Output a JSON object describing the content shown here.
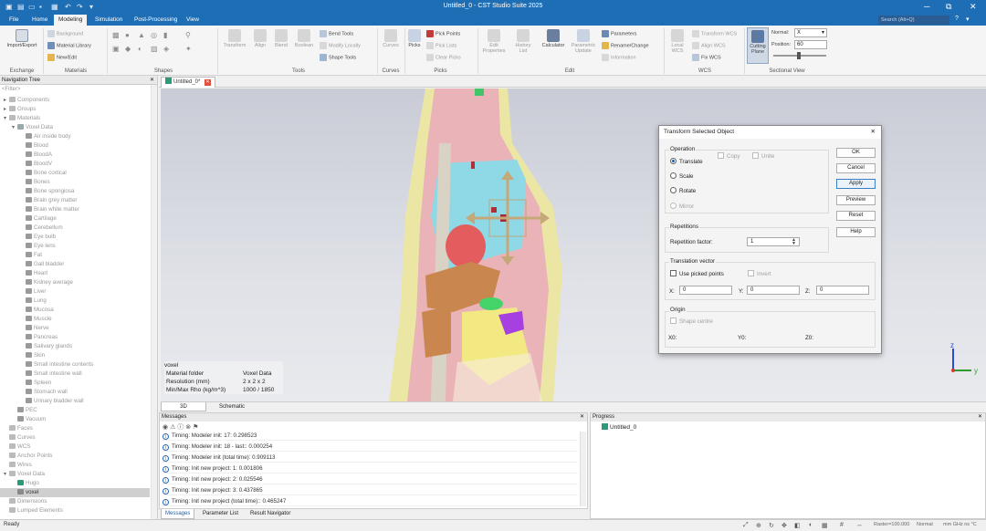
{
  "titlebar": {
    "title": "Untitled_0 - CST Studio Suite 2025",
    "win_min": "─",
    "win_max": "◻",
    "win_close": "✕",
    "win_restore": "⧉"
  },
  "menu": {
    "tabs": [
      "File",
      "Home",
      "Modeling",
      "Simulation",
      "Post-Processing",
      "View"
    ],
    "active": "Modeling",
    "search_placeholder": "Search (Alt+Q)"
  },
  "ribbon": {
    "exchange": {
      "import_export": "Import/Export",
      "group": "Exchange"
    },
    "materials": {
      "background": "Background",
      "material_library": "Material Library",
      "new_edit": "New/Edit",
      "group": "Materials"
    },
    "shapes": {
      "group": "Shapes"
    },
    "tools": {
      "transform": "Transform",
      "align": "Align",
      "blend": "Blend",
      "boolean": "Boolean",
      "bend_tools": "Bend Tools",
      "modify_locally": "Modify Locally",
      "shape_tools": "Shape Tools",
      "group": "Tools"
    },
    "curves": {
      "curves": "Curves",
      "group": "Curves"
    },
    "picks": {
      "picks": "Picks",
      "pick_points": "Pick Points",
      "pick_lists": "Pick Lists",
      "clear_picks": "Clear Picks",
      "group": "Picks"
    },
    "edit": {
      "edit_properties": "Edit Properties",
      "history_list": "History List",
      "calculator": "Calculator",
      "parametric_update": "Parametric Update",
      "parameters": "Parameters",
      "rename_change": "Rename/Change",
      "information": "Information",
      "group": "Edit"
    },
    "wcs": {
      "local_wcs": "Local WCS",
      "transform_wcs": "Transform WCS",
      "align_wcs": "Align WCS",
      "fix_wcs": "Fix WCS",
      "group": "WCS"
    },
    "sectional": {
      "cutting_plane": "Cutting Plane",
      "normal_label": "Normal:",
      "normal_value": "X",
      "position_label": "Position:",
      "position_value": "60",
      "group": "Sectional View"
    }
  },
  "nav": {
    "title": "Navigation Tree",
    "filter": "<Filter>",
    "items": [
      {
        "label": "Components"
      },
      {
        "label": "Groups"
      },
      {
        "label": "Materials"
      },
      {
        "label": "Voxel Data"
      },
      {
        "label": "Air inside body"
      },
      {
        "label": "Blood"
      },
      {
        "label": "BloodA"
      },
      {
        "label": "BloodV"
      },
      {
        "label": "Bone cortical"
      },
      {
        "label": "Bones"
      },
      {
        "label": "Bone spongiosa"
      },
      {
        "label": "Brain grey matter"
      },
      {
        "label": "Brain white matter"
      },
      {
        "label": "Cartilage"
      },
      {
        "label": "Cerebellum"
      },
      {
        "label": "Eye bulb"
      },
      {
        "label": "Eye lens"
      },
      {
        "label": "Fat"
      },
      {
        "label": "Gall bladder"
      },
      {
        "label": "Heart"
      },
      {
        "label": "Kidney average"
      },
      {
        "label": "Liver"
      },
      {
        "label": "Lung"
      },
      {
        "label": "Mucosa"
      },
      {
        "label": "Muscle"
      },
      {
        "label": "Nerve"
      },
      {
        "label": "Pancreas"
      },
      {
        "label": "Salivary glands"
      },
      {
        "label": "Skin"
      },
      {
        "label": "Small intestine contents"
      },
      {
        "label": "Small intestine wall"
      },
      {
        "label": "Spleen"
      },
      {
        "label": "Stomach wall"
      },
      {
        "label": "Urinary bladder wall"
      },
      {
        "label": "PEC"
      },
      {
        "label": "Vacuum"
      },
      {
        "label": "Faces"
      },
      {
        "label": "Curves"
      },
      {
        "label": "WCS"
      },
      {
        "label": "Anchor Points"
      },
      {
        "label": "Wires"
      },
      {
        "label": "Voxel Data"
      },
      {
        "label": "Hugo"
      },
      {
        "label": "voxel"
      },
      {
        "label": "Dimensions"
      },
      {
        "label": "Lumped Elements"
      }
    ]
  },
  "doc": {
    "tab": "Untitled_0*"
  },
  "viewport": {
    "info_name": "voxel",
    "rows": [
      {
        "k": "Material folder",
        "v": "Voxel Data"
      },
      {
        "k": "Resolution (mm)",
        "v": "2 x 2 x 2"
      },
      {
        "k": "Min/Max Rho (kg/m^3)",
        "v": "1000 / 1850"
      }
    ],
    "axis_z": "z",
    "axis_y": "y",
    "tabs": [
      "3D",
      "Schematic"
    ]
  },
  "dialog": {
    "title": "Transform Selected Object",
    "operation": "Operation",
    "translate": "Translate",
    "scale": "Scale",
    "rotate": "Rotate",
    "mirror": "Mirror",
    "copy": "Copy",
    "unite": "Unite",
    "repetitions": "Repetitions",
    "repetition_factor": "Repetition factor:",
    "repetition_value": "1",
    "translation_vector": "Translation vector",
    "use_picked_points": "Use picked points",
    "invert": "Invert",
    "x_label": "X:",
    "x_value": "0",
    "y_label": "Y:",
    "y_value": "0",
    "z_label": "Z:",
    "z_value": "0",
    "origin": "Origin",
    "shape_centre": "Shape centre",
    "x0": "X0:",
    "y0": "Y0:",
    "z0": "Z0:",
    "buttons": [
      "OK",
      "Cancel",
      "Apply",
      "Preview",
      "Reset",
      "Help"
    ]
  },
  "messages": {
    "title": "Messages",
    "items": [
      "Timing: Modeler init: 17: 0.298523",
      "Timing: Modeler init: 18 - last:: 0.000254",
      "Timing: Modeler init (total time): 0.909113",
      "Timing: Init new project: 1: 0.001806",
      "Timing: Init new project: 2: 0.025546",
      "Timing: Init new project: 3: 0.437865",
      "Timing: Init new project (total time):: 0.465247"
    ],
    "tabs": [
      "Messages",
      "Parameter List",
      "Result Navigator"
    ]
  },
  "progress": {
    "title": "Progress",
    "item": "Untitled_0"
  },
  "status": {
    "text": "Ready",
    "raster": "Raster=100.000",
    "normal": "Normal",
    "units": "mm GHz ns °C"
  },
  "colors": {
    "accent": "#1e6eb5"
  }
}
